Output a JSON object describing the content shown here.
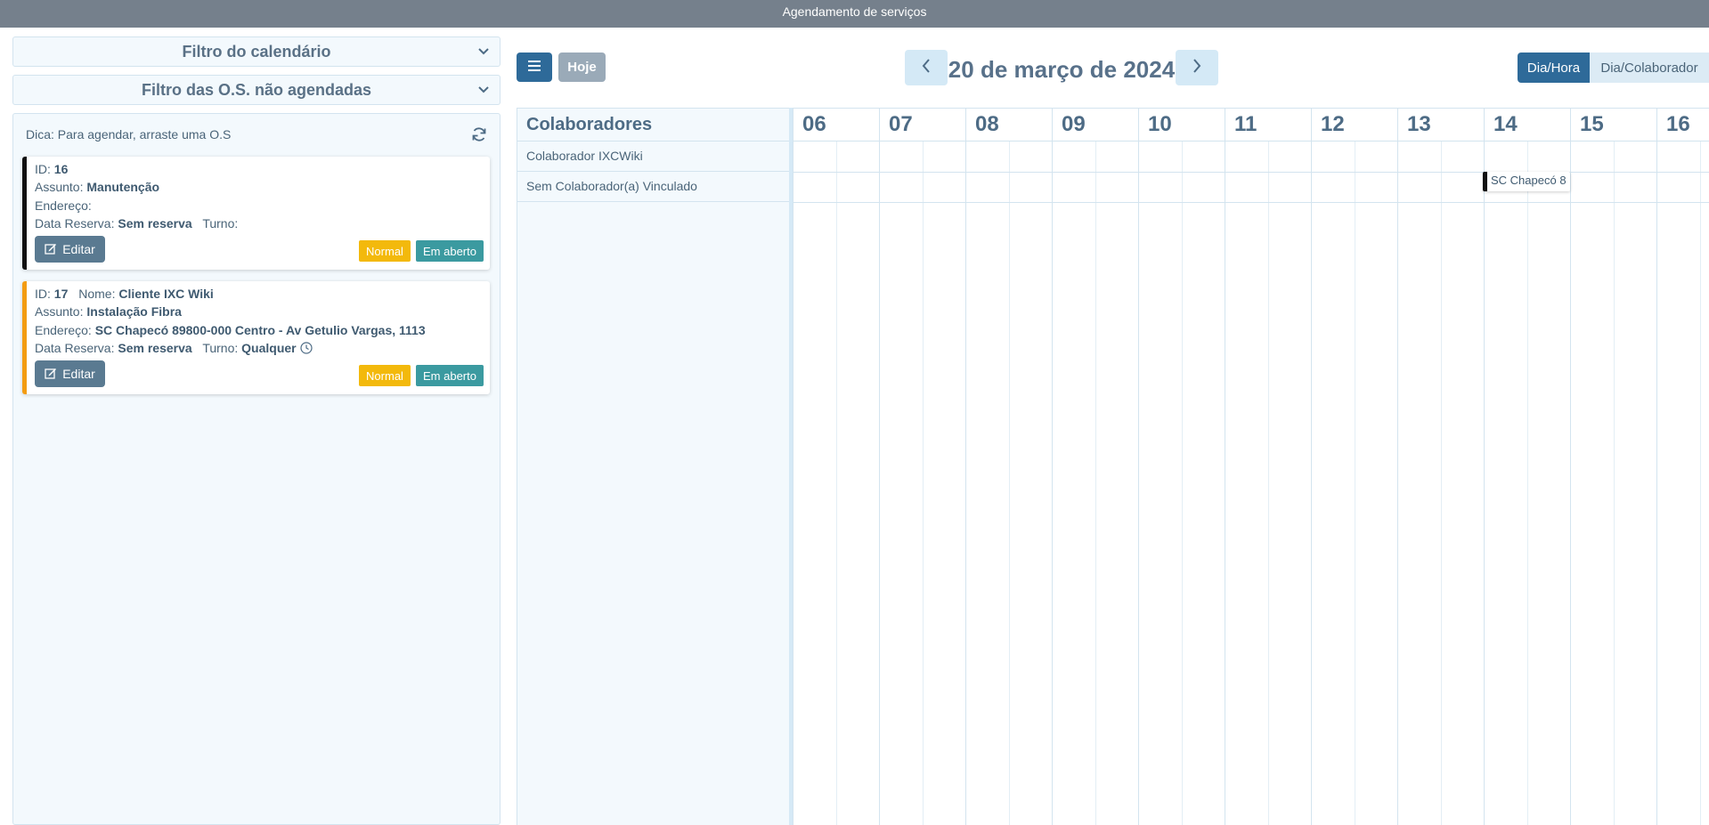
{
  "window": {
    "title": "Agendamento de serviços"
  },
  "left": {
    "filter_calendar": "Filtro do calendário",
    "filter_unscheduled": "Filtro das O.S. não agendadas",
    "tip": "Dica: Para agendar, arraste uma O.S",
    "cards": [
      {
        "bar_color": "#111111",
        "id_label": "ID:",
        "id": "16",
        "assunto_label": "Assunto:",
        "assunto": "Manutenção",
        "endereco_label": "Endereço:",
        "endereco": "",
        "reserva_label": "Data Reserva:",
        "reserva": "Sem reserva",
        "turno_label": "Turno:",
        "turno": "",
        "edit": "Editar",
        "priority": "Normal",
        "status": "Em aberto"
      },
      {
        "bar_color": "#f39c12",
        "id_label": "ID:",
        "id": "17",
        "nome_label": "Nome:",
        "nome": "Cliente IXC Wiki",
        "assunto_label": "Assunto:",
        "assunto": "Instalação Fibra",
        "endereco_label": "Endereço:",
        "endereco": "SC Chapecó 89800-000 Centro - Av Getulio Vargas, 1113",
        "reserva_label": "Data Reserva:",
        "reserva": "Sem reserva",
        "turno_label": "Turno:",
        "turno": "Qualquer",
        "edit": "Editar",
        "priority": "Normal",
        "status": "Em aberto"
      }
    ]
  },
  "toolbar": {
    "menu_icon": "hamburger-icon",
    "today": "Hoje",
    "date": "20 de março de 2024",
    "views": [
      "Dia/Hora",
      "Dia/Colaborador"
    ],
    "active_view": "Dia/Hora"
  },
  "timeline": {
    "resource_header": "Colaboradores",
    "resources": [
      "Colaborador IXCWiki",
      "Sem Colaborador(a) Vinculado"
    ],
    "hours": [
      "06",
      "07",
      "08",
      "09",
      "10",
      "11",
      "12",
      "13",
      "14",
      "15",
      "16"
    ],
    "event": {
      "text": "SC Chapecó 8",
      "resource": "Sem Colaborador(a) Vinculado",
      "start_hour": "14"
    }
  },
  "colors": {
    "accent": "#2e6a99",
    "titlebar": "#75808c",
    "priority_normal": "#f3b90c",
    "status_open": "#3b9aa0"
  }
}
